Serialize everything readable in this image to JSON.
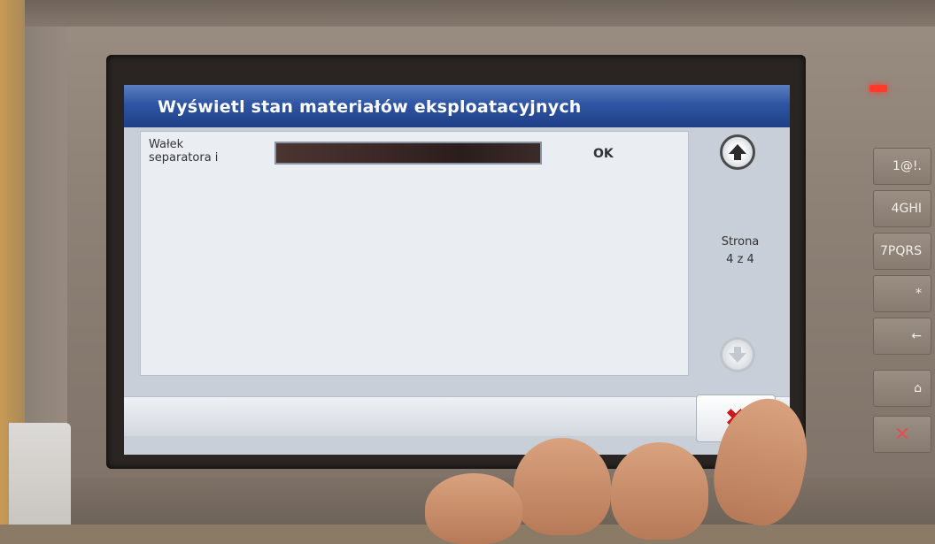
{
  "screen": {
    "title": "Wyświetl stan materiałów eksploatacyjnych",
    "items": [
      {
        "label_line1": "Wałek",
        "label_line2": "separatora i",
        "status": "OK"
      }
    ],
    "page": {
      "label": "Strona",
      "indicator": "4 z 4"
    },
    "cancel_symbol": "✖"
  },
  "keypad": {
    "keys": [
      "1@!.",
      "4GHI",
      "7PQRS",
      "*",
      "←",
      "⌂",
      "✕"
    ]
  },
  "colors": {
    "title_bar": "#2f55a3",
    "cancel_x": "#cc1a1a",
    "led": "#ff3a2a"
  }
}
